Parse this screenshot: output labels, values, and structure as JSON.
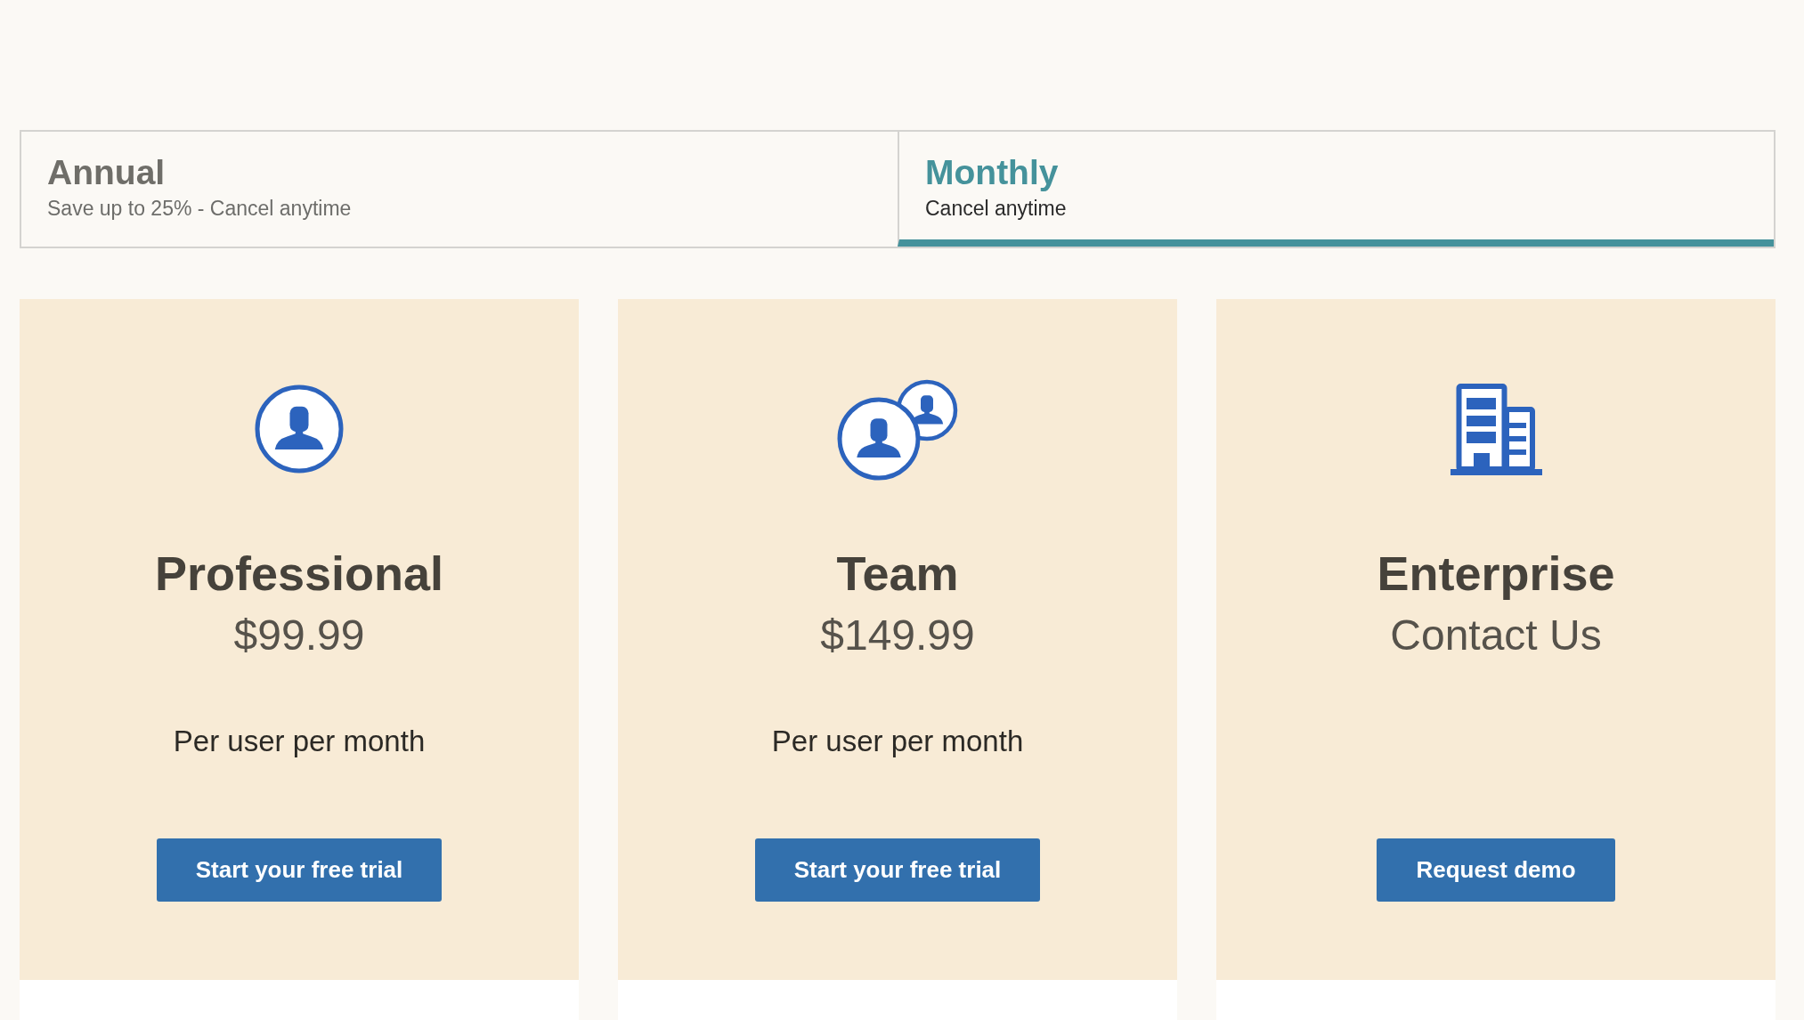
{
  "billing_tabs": [
    {
      "title": "Annual",
      "subtitle": "Save up to 25% - Cancel anytime",
      "selected": false
    },
    {
      "title": "Monthly",
      "subtitle": "Cancel anytime",
      "selected": true
    }
  ],
  "plans": [
    {
      "kind": "single",
      "name": "Professional",
      "price": "$99.99",
      "note": "Per user per month",
      "button": "Start your free trial"
    },
    {
      "kind": "team",
      "name": "Team",
      "price": "$149.99",
      "note": "Per user per month",
      "button": "Start your free trial"
    },
    {
      "kind": "enterprise",
      "name": "Enterprise",
      "price": "Contact Us",
      "button": "Request demo"
    }
  ]
}
